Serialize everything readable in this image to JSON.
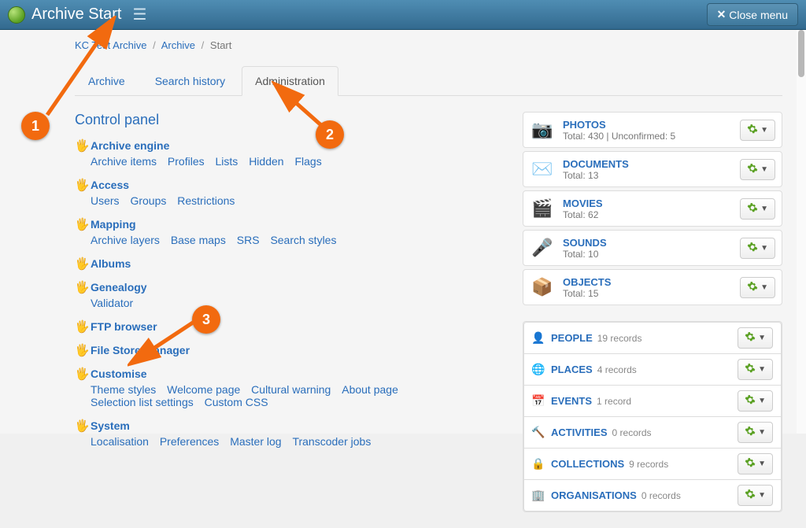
{
  "app": {
    "title_html": "Archive Start"
  },
  "header": {
    "close_label": "Close menu"
  },
  "breadcrumb": {
    "b1": "KC Test Archive",
    "b2": "Archive",
    "b3": "Start"
  },
  "tabs": {
    "archive": "Archive",
    "search_history": "Search history",
    "administration": "Administration"
  },
  "control_panel": {
    "heading": "Control panel"
  },
  "sections": [
    {
      "title": "Archive engine",
      "links": [
        "Archive items",
        "Profiles",
        "Lists",
        "Hidden",
        "Flags"
      ]
    },
    {
      "title": "Access",
      "links": [
        "Users",
        "Groups",
        "Restrictions"
      ]
    },
    {
      "title": "Mapping",
      "links": [
        "Archive layers",
        "Base maps",
        "SRS",
        "Search styles"
      ]
    },
    {
      "title": "Albums",
      "links": []
    },
    {
      "title": "Genealogy",
      "links": [
        "Validator"
      ]
    },
    {
      "title": "FTP browser",
      "links": []
    },
    {
      "title": "File Store manager",
      "links": []
    },
    {
      "title": "Customise",
      "links": [
        "Theme styles",
        "Welcome page",
        "Cultural warning",
        "About page",
        "Selection list settings",
        "Custom CSS"
      ]
    },
    {
      "title": "System",
      "links": [
        "Localisation",
        "Preferences",
        "Master log",
        "Transcoder jobs"
      ]
    }
  ],
  "media_cards": [
    {
      "icon": "camera-icon",
      "glyph": "📷",
      "title": "PHOTOS",
      "sub": "Total: 430 | Unconfirmed: 5"
    },
    {
      "icon": "envelope-icon",
      "glyph": "✉️",
      "title": "DOCUMENTS",
      "sub": "Total: 13"
    },
    {
      "icon": "clapper-icon",
      "glyph": "🎬",
      "title": "MOVIES",
      "sub": "Total: 62"
    },
    {
      "icon": "microphone-icon",
      "glyph": "🎤",
      "title": "SOUNDS",
      "sub": "Total: 10"
    },
    {
      "icon": "box-icon",
      "glyph": "📦",
      "title": "OBJECTS",
      "sub": "Total: 15"
    }
  ],
  "entity_rows": [
    {
      "icon": "person-icon",
      "glyph": "👤",
      "title": "PEOPLE",
      "sub": "19 records"
    },
    {
      "icon": "globe-icon",
      "glyph": "🌐",
      "title": "PLACES",
      "sub": "4 records"
    },
    {
      "icon": "calendar-icon",
      "glyph": "📅",
      "title": "EVENTS",
      "sub": "1 record"
    },
    {
      "icon": "hammer-icon",
      "glyph": "🔨",
      "title": "ACTIVITIES",
      "sub": "0 records"
    },
    {
      "icon": "padlock-icon",
      "glyph": "🔒",
      "title": "COLLECTIONS",
      "sub": "9 records"
    },
    {
      "icon": "building-icon",
      "glyph": "🏢",
      "title": "ORGANISATIONS",
      "sub": "0 records"
    }
  ],
  "annotations": {
    "n1": "1",
    "n2": "2",
    "n3": "3"
  }
}
